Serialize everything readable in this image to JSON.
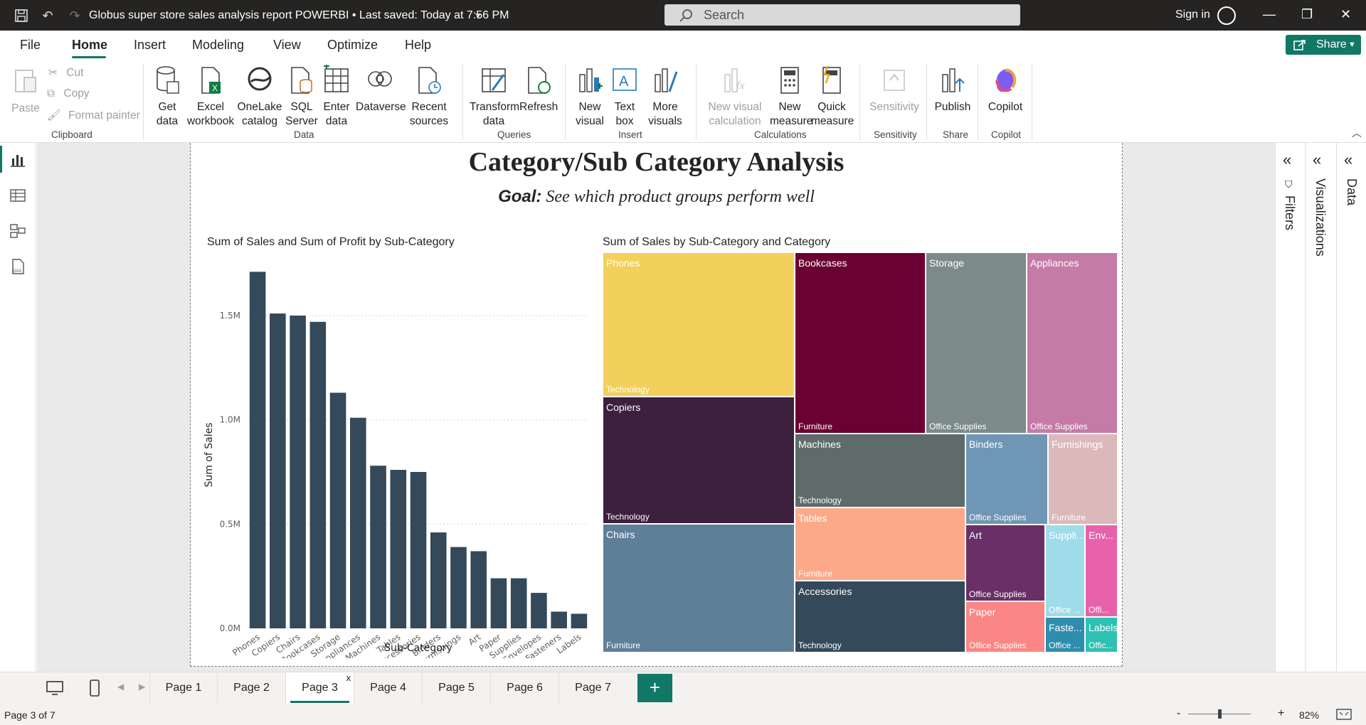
{
  "window": {
    "title": "Globus super store sales analysis report POWERBI • Last saved: Today at 7:56 PM",
    "search_placeholder": "Search",
    "sign_in": "Sign in"
  },
  "menu": {
    "items": [
      "File",
      "Home",
      "Insert",
      "Modeling",
      "View",
      "Optimize",
      "Help"
    ],
    "active": "Home",
    "share": "Share"
  },
  "ribbon": {
    "clipboard": {
      "paste": "Paste",
      "cut": "Cut",
      "copy": "Copy",
      "format_painter": "Format painter",
      "label": "Clipboard"
    },
    "data": {
      "get_data": [
        "Get",
        "data"
      ],
      "excel": [
        "Excel",
        "workbook"
      ],
      "onelake": [
        "OneLake",
        "catalog"
      ],
      "sql": [
        "SQL",
        "Server"
      ],
      "enter": [
        "Enter",
        "data"
      ],
      "dataverse": "Dataverse",
      "recent": [
        "Recent",
        "sources"
      ],
      "label": "Data"
    },
    "queries": {
      "transform": [
        "Transform",
        "data"
      ],
      "refresh": "Refresh",
      "label": "Queries"
    },
    "insert": {
      "new_visual": [
        "New",
        "visual"
      ],
      "text_box": [
        "Text",
        "box"
      ],
      "more_visuals": [
        "More",
        "visuals"
      ],
      "label": "Insert"
    },
    "calculations": {
      "new_visual_calc": [
        "New visual",
        "calculation"
      ],
      "new_measure": [
        "New",
        "measure"
      ],
      "quick_measure": [
        "Quick",
        "measure"
      ],
      "label": "Calculations"
    },
    "sensitivity": {
      "btn": "Sensitivity",
      "label": "Sensitivity"
    },
    "share": {
      "publish": "Publish",
      "label": "Share"
    },
    "copilot": {
      "btn": "Copilot",
      "label": "Copilot"
    }
  },
  "report": {
    "title": "Category/Sub Category Analysis",
    "goal_label": "Goal:",
    "goal_text": " See which product groups perform well"
  },
  "chart_data": [
    {
      "type": "bar",
      "title": "Sum of Sales and Sum of Profit by Sub-Category",
      "xlabel": "Sub-Category",
      "ylabel": "Sum of Sales",
      "categories": [
        "Phones",
        "Copiers",
        "Chairs",
        "Bookcases",
        "Storage",
        "Appliances",
        "Machines",
        "Tables",
        "Accessories",
        "Binders",
        "Furnishings",
        "Art",
        "Paper",
        "Supplies",
        "Envelopes",
        "Fasteners",
        "Labels"
      ],
      "values": [
        1.71,
        1.51,
        1.5,
        1.47,
        1.13,
        1.01,
        0.78,
        0.76,
        0.75,
        0.46,
        0.39,
        0.37,
        0.24,
        0.24,
        0.17,
        0.08,
        0.07
      ],
      "ylim": [
        0,
        1.8
      ],
      "yticks": [
        "0.0M",
        "0.5M",
        "1.0M",
        "1.5M"
      ],
      "color": "#34495a",
      "grid": true
    },
    {
      "type": "treemap",
      "title": "Sum of Sales by Sub-Category and Category",
      "cells": [
        {
          "name": "Phones",
          "category": "Technology",
          "color": "#f2d05b"
        },
        {
          "name": "Copiers",
          "category": "Technology",
          "color": "#3d1f3e"
        },
        {
          "name": "Chairs",
          "category": "Furniture",
          "color": "#5e7f98"
        },
        {
          "name": "Bookcases",
          "category": "Furniture",
          "color": "#6b0032"
        },
        {
          "name": "Storage",
          "category": "Office Supplies",
          "color": "#7d8a8a"
        },
        {
          "name": "Appliances",
          "category": "Office Supplies",
          "color": "#c57ba6"
        },
        {
          "name": "Machines",
          "category": "Technology",
          "color": "#5f6b6b"
        },
        {
          "name": "Tables",
          "category": "Furniture",
          "color": "#fca98a"
        },
        {
          "name": "Accessories",
          "category": "Technology",
          "color": "#34495a"
        },
        {
          "name": "Binders",
          "category": "Office Supplies",
          "color": "#6f96b5"
        },
        {
          "name": "Furnishings",
          "category": "Furniture",
          "color": "#dbb9bb"
        },
        {
          "name": "Art",
          "category": "Office Supplies",
          "color": "#6a2f66"
        },
        {
          "name": "Paper",
          "category": "Office Supplies",
          "color": "#fa8785"
        },
        {
          "name": "Suppli...",
          "category": "Office ...",
          "color": "#9fdce9"
        },
        {
          "name": "Env...",
          "category": "Offi...",
          "color": "#e861ab"
        },
        {
          "name": "Faste...",
          "category": "Office ...",
          "color": "#2e8dad"
        },
        {
          "name": "Labels",
          "category": "Offic...",
          "color": "#2ec0b2"
        }
      ]
    }
  ],
  "panes": {
    "filters": "Filters",
    "visualizations": "Visualizations",
    "data": "Data"
  },
  "pages": {
    "tabs": [
      "Page 1",
      "Page 2",
      "Page 3",
      "Page 4",
      "Page 5",
      "Page 6",
      "Page 7"
    ],
    "active": "Page 3",
    "close_mark": "x",
    "add": "+"
  },
  "status": {
    "page_info": "Page 3 of 7",
    "zoom": "82%",
    "zoom_minus": "-",
    "zoom_plus": "+"
  },
  "colors": {
    "accent": "#117865",
    "titlebar": "#252423"
  }
}
